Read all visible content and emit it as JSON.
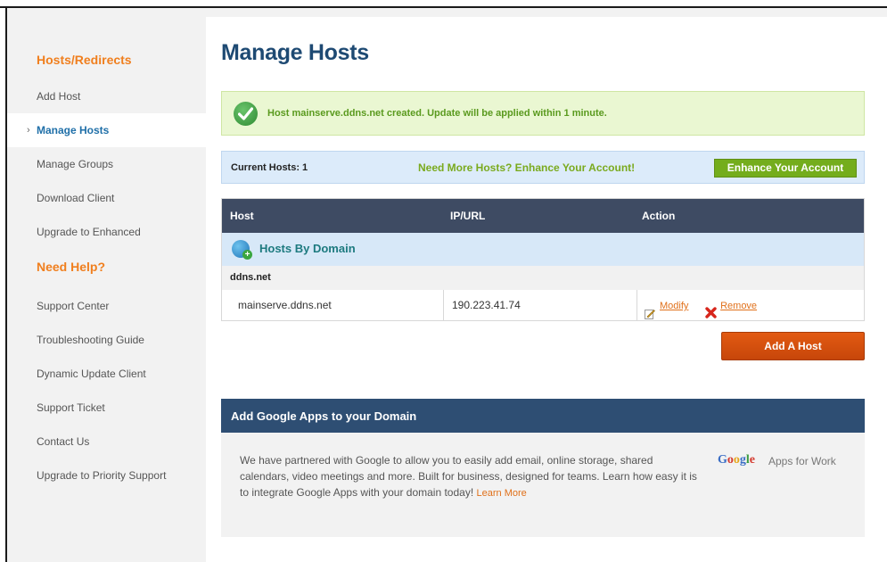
{
  "sidebar": {
    "section1_title": "Hosts/Redirects",
    "section2_title": "Need Help?",
    "items1": [
      {
        "label": "Add Host"
      },
      {
        "label": "Manage Hosts",
        "active": true
      },
      {
        "label": "Manage Groups"
      },
      {
        "label": "Download Client"
      },
      {
        "label": "Upgrade to Enhanced"
      }
    ],
    "items2": [
      {
        "label": "Support Center"
      },
      {
        "label": "Troubleshooting Guide"
      },
      {
        "label": "Dynamic Update Client"
      },
      {
        "label": "Support Ticket"
      },
      {
        "label": "Contact Us"
      },
      {
        "label": "Upgrade to Priority Support"
      }
    ]
  },
  "page_title": "Manage Hosts",
  "success_message": "Host mainserve.ddns.net created. Update will be applied within 1 minute.",
  "hosts_bar": {
    "current_hosts": "Current Hosts: 1",
    "promo": "Need More Hosts? Enhance Your Account!",
    "enhance_button": "Enhance Your Account"
  },
  "table": {
    "headers": {
      "host": "Host",
      "ip": "IP/URL",
      "action": "Action"
    },
    "group_label": "Hosts By Domain",
    "domain": "ddns.net",
    "rows": [
      {
        "host": "mainserve.ddns.net",
        "ip": "190.223.41.74",
        "modify": "Modify",
        "remove": "Remove"
      }
    ]
  },
  "add_host_button": "Add A Host",
  "google_apps": {
    "heading": "Add Google Apps to your Domain",
    "body": "We have partnered with Google to allow you to easily add email, online storage, shared calendars, video meetings and more. Built for business, designed for teams. Learn how easy it is to integrate Google Apps with your domain today!",
    "learn_more": "Learn More",
    "logo_word": "Google",
    "logo_suffix": "Apps for Work"
  },
  "colors": {
    "accent_orange": "#f07f1e",
    "title_blue": "#1e4a73",
    "success_green": "#5a9a1e",
    "enhance_green": "#74ad1c",
    "table_header": "#3e4b63",
    "add_button": "#d9500e"
  },
  "icons": {
    "success": "check-circle-icon",
    "group": "globe-add-icon",
    "modify": "pencil-icon",
    "remove": "red-x-icon"
  }
}
